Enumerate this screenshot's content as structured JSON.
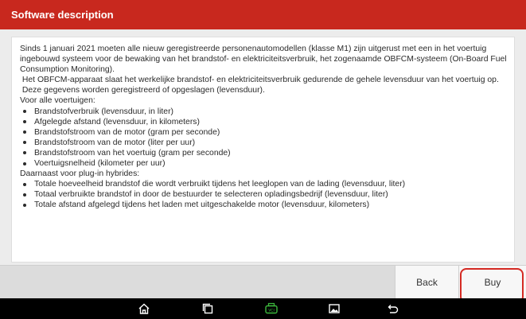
{
  "header": {
    "title": "Software description"
  },
  "description": {
    "intro": [
      "Sinds 1 januari 2021 moeten alle nieuw geregistreerde personenautomodellen (klasse M1) zijn uitgerust met een in het voertuig ingebouwd systeem voor de bewaking van het brandstof- en elektriciteitsverbruik, het zogenaamde OBFCM-systeem (On-Board Fuel Consumption Monitoring).",
      " Het OBFCM-apparaat slaat het werkelijke brandstof- en elektriciteitsverbruik gedurende de gehele levensduur van het voertuig op.",
      " Deze gegevens worden geregistreerd of opgeslagen (levensduur).",
      "Voor alle voertuigen:"
    ],
    "all_vehicles": [
      "Brandstofverbruik (levensduur, in liter)",
      "Afgelegde afstand (levensduur, in kilometers)",
      "Brandstofstroom van de motor (gram per seconde)",
      "Brandstofstroom van de motor (liter per uur)",
      "Brandstofstroom van het voertuig (gram per seconde)",
      "Voertuigsnelheid (kilometer per uur)"
    ],
    "hybrid_heading": "Daarnaast voor plug-in hybrides:",
    "hybrids": [
      "Totale hoeveelheid brandstof die wordt verbruikt tijdens het leeglopen van de lading (levensduur, liter)",
      "Totaal verbruikte brandstof in door de bestuurder te selecteren opladingsbedrijf (levensduur, liter)",
      "Totale afstand afgelegd tijdens het laden met uitgeschakelde motor (levensduur, kilometers)"
    ]
  },
  "footer": {
    "back_label": "Back",
    "buy_label": "Buy"
  },
  "navbar": {
    "icons": [
      "home-icon",
      "recent-apps-icon",
      "vci-icon",
      "screenshot-icon",
      "back-arrow-icon"
    ]
  },
  "colors": {
    "header": "#c8281e",
    "highlight": "#d42a23",
    "vci_icon": "#3cb83c"
  }
}
